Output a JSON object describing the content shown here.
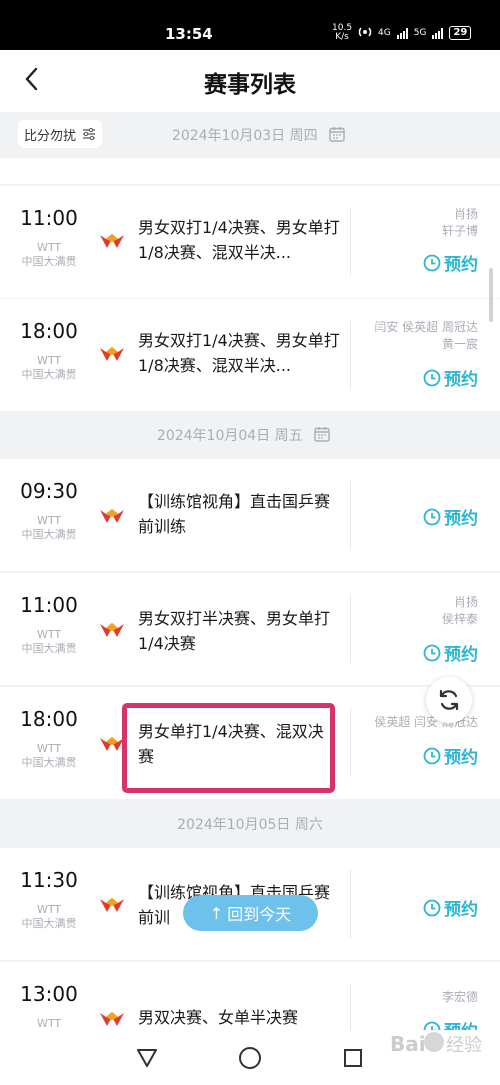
{
  "status": {
    "time": "13:54",
    "speed_value": "10.5",
    "speed_unit": "K/s",
    "network1": "4G",
    "network2": "5G",
    "battery": "29"
  },
  "header": {
    "title": "赛事列表"
  },
  "filter": {
    "label": "比分勿扰"
  },
  "dates": [
    {
      "date": "2024年10月03日",
      "weekday": "周四"
    },
    {
      "date": "2024年10月04日",
      "weekday": "周五"
    },
    {
      "date": "2024年10月05日",
      "weekday": "周六"
    }
  ],
  "matches": [
    {
      "time": "11:00",
      "org": "WTT",
      "event": "中国大满贯",
      "title": "男女双打1/4决赛、男女单打1/8决赛、混双半决...",
      "players": [
        "肖扬",
        "轩子博"
      ],
      "action": "预约"
    },
    {
      "time": "18:00",
      "org": "WTT",
      "event": "中国大满贯",
      "title": "男女双打1/4决赛、男女单打1/8决赛、混双半决...",
      "players": [
        "闫安 侯英超 周冠达",
        "黄一宸"
      ],
      "action": "预约"
    },
    {
      "time": "09:30",
      "org": "WTT",
      "event": "中国大满贯",
      "title": "【训练馆视角】直击国乒赛前训练",
      "players": [],
      "action": "预约"
    },
    {
      "time": "11:00",
      "org": "WTT",
      "event": "中国大满贯",
      "title": "男女双打半决赛、男女单打1/4决赛",
      "players": [
        "肖扬",
        "侯梓泰"
      ],
      "action": "预约"
    },
    {
      "time": "18:00",
      "org": "WTT",
      "event": "中国大满贯",
      "title": "男女单打1/4决赛、混双决赛",
      "players": [
        "侯英超 闫安 周冠达"
      ],
      "action": "预约"
    },
    {
      "time": "11:30",
      "org": "WTT",
      "event": "中国大满贯",
      "title": "【训练馆视角】直击国乒赛前训",
      "players": [],
      "action": "预约"
    },
    {
      "time": "13:00",
      "org": "WTT",
      "event": "",
      "title": "男双决赛、女单半决赛",
      "players": [
        "李宏德"
      ],
      "action": "预约"
    }
  ],
  "floating": {
    "today_label": "回到今天",
    "today_arrow": "↑"
  },
  "icons": {
    "back": "chevron-left-icon",
    "calendar": "calendar-icon",
    "clock": "clock-icon",
    "refresh": "refresh-icon",
    "filter": "filter-lines-icon"
  },
  "colors": {
    "accent": "#2db6d6",
    "highlight": "#d6336c",
    "today_button": "#6ec1ea"
  },
  "watermark": "Bai 经验"
}
